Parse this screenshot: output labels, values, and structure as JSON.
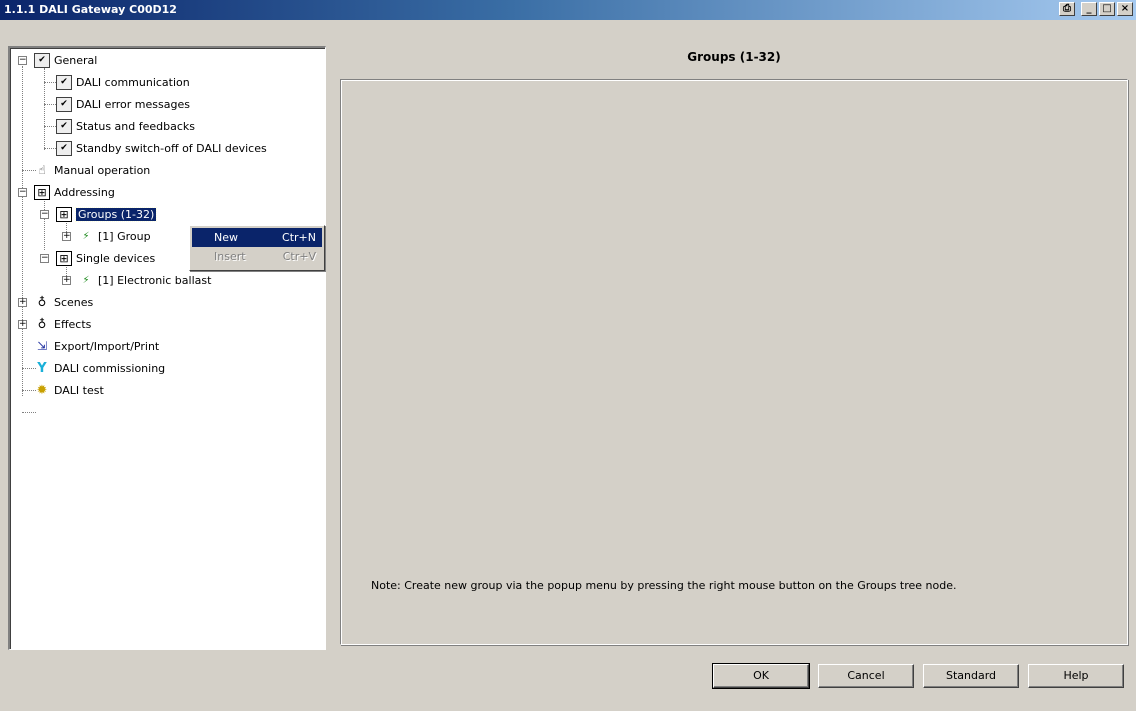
{
  "window": {
    "title": "1.1.1 DALI Gateway C00D12",
    "buttons": {
      "print": "⎙",
      "minimize": "_",
      "maximize": "□",
      "close": "×"
    }
  },
  "tree": {
    "general": "General",
    "dali_communication": "DALI communication",
    "dali_error_messages": "DALI error messages",
    "status_feedbacks": "Status and feedbacks",
    "standby_switch_off": "Standby switch-off of DALI devices",
    "manual_operation": "Manual operation",
    "addressing": "Addressing",
    "groups": "Groups (1-32)",
    "group_1": "[1] Group",
    "single_devices": "Single devices",
    "electronic_ballast": "[1] Electronic ballast",
    "scenes": "Scenes",
    "effects": "Effects",
    "export_import_print": "Export/Import/Print",
    "dali_commissioning": "DALI commissioning",
    "dali_test": "DALI test"
  },
  "context_menu": {
    "items": [
      {
        "label": "New",
        "shortcut": "Ctr+N",
        "enabled": true
      },
      {
        "label": "Insert",
        "shortcut": "Ctr+V",
        "enabled": false
      }
    ]
  },
  "panel": {
    "title": "Groups (1-32)",
    "note": "Note: Create new group via the popup menu by pressing the right  mouse button on the Groups tree node."
  },
  "buttons": {
    "ok": "OK",
    "cancel": "Cancel",
    "standard": "Standard",
    "help": "Help"
  },
  "icons": {
    "check": "✔",
    "grid": "⊞",
    "bulb": "♁",
    "device": "⚡",
    "hand": "☝",
    "export": "⇲",
    "wrench": "Y",
    "gear": "✹",
    "expand": "+",
    "collapse": "−"
  }
}
